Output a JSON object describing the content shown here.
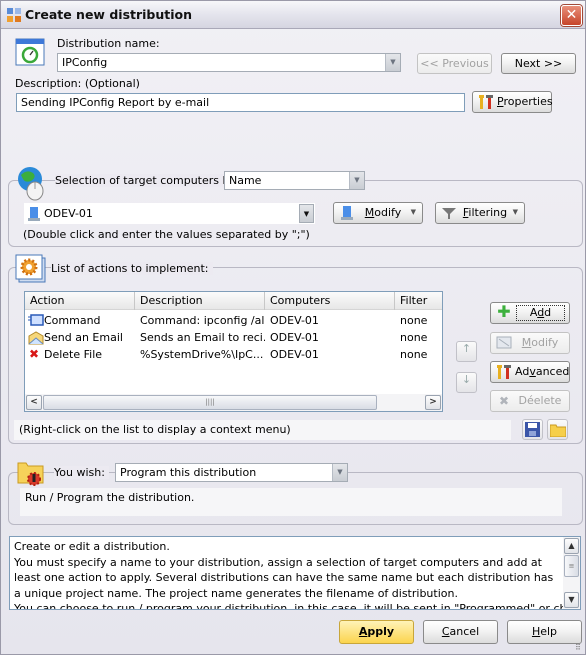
{
  "window": {
    "title": "Create new distribution",
    "close_label": "✕"
  },
  "general": {
    "name_label": "Distribution name:",
    "name_value": "IPConfig",
    "description_label": "Description: (Optional)",
    "description_value": "Sending IPConfig Report by e-mail",
    "previous_label": "<< Previous",
    "next_label": "Next >>",
    "properties_label_u": "P",
    "properties_label_rest": "roperties"
  },
  "targets": {
    "selection_label": "Selection of target computers by",
    "selection_mode": "Name",
    "computer_value": "ODEV-01",
    "hint": "(Double click and enter the values separated by \";\")",
    "modify_u": "M",
    "modify_rest": "odify",
    "filtering_u": "F",
    "filtering_rest": "iltering"
  },
  "actions": {
    "group_label": "List of actions to implement:",
    "columns": [
      "Action",
      "Description",
      "Computers",
      "Filter"
    ],
    "rows": [
      {
        "icon": "command-icon",
        "action": "Command",
        "description": "Command: ipconfig /al...",
        "computers": "ODEV-01",
        "filter": "none"
      },
      {
        "icon": "email-icon",
        "action": "Send an Email",
        "description": "Sends an Email to reci...",
        "computers": "ODEV-01",
        "filter": "none"
      },
      {
        "icon": "delete-icon",
        "action": "Delete  File",
        "description": "%SystemDrive%\\IpC...",
        "computers": "ODEV-01",
        "filter": "none"
      }
    ],
    "add_pre": "A",
    "add_u": "d",
    "add_post": "d",
    "modify_u": "M",
    "modify_rest": "odify",
    "advanced_pre": "Ad",
    "advanced_u": "v",
    "advanced_post": "anced",
    "delete_label": "Déelete",
    "context_hint": "(Right-click on the list to display a context menu)"
  },
  "wish": {
    "label": "You wish:",
    "value": "Program this distribution",
    "description": "Run / Program the distribution."
  },
  "help_text": {
    "lines": [
      "Create or edit a distribution.",
      "You must specify a name to your distribution, assign a selection of target computers and add at least one action to apply. Several distributions can have the same name but each distribution has a unique project name. The project name generates the filename of distribution.",
      "You can choose to run / program your distribution, in this case, it will be sent in \"Programmed\" or choose to save"
    ]
  },
  "footer": {
    "apply_u": "A",
    "apply_rest": "pply",
    "cancel_u": "C",
    "cancel_rest": "ancel",
    "help_u": "H",
    "help_rest": "elp"
  },
  "colors": {
    "apply_button": "#fbd44e",
    "close_button": "#c6452b",
    "field_border": "#7f9db9"
  }
}
